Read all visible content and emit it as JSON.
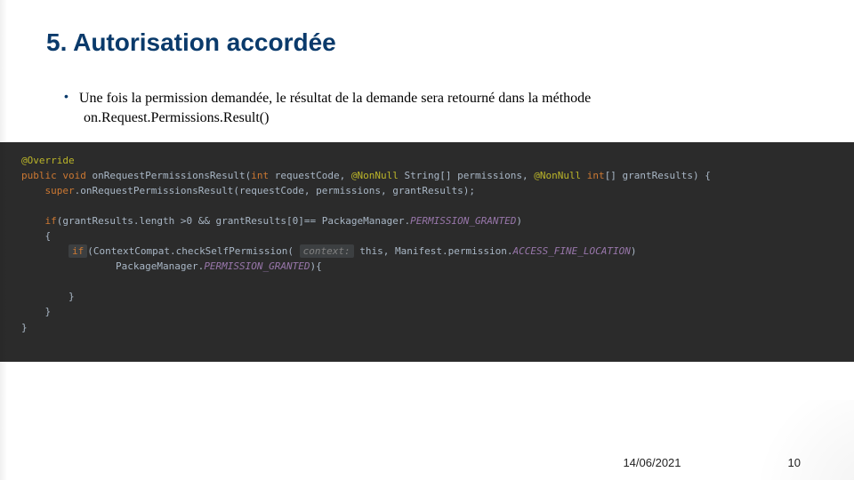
{
  "title": "5. Autorisation accordée",
  "bullet": {
    "text": "Une fois la permission demandée, le résultat de la demande sera retourné dans la méthode",
    "method": "on.Request.Permissions.Result()"
  },
  "code": {
    "l1a": "@Override",
    "l2_kw1": "public void",
    "l2_name": " onRequestPermissionsResult(",
    "l2_kw2": "int",
    "l2_p1": " requestCode, ",
    "l2_ann1": "@NonNull",
    "l2_p2": " String[] permissions, ",
    "l2_ann2": "@NonNull",
    "l2_kw3": " int",
    "l2_p3": "[] grantResults) {",
    "l3_kw": "super",
    "l3_rest": ".onRequestPermissionsResult(requestCode, permissions, grantResults);",
    "l5_kw": "if",
    "l5_rest": "(grantResults.length >0 && grantResults[0]== PackageManager.",
    "l5_const": "PERMISSION_GRANTED",
    "l5_end": ")",
    "l6": "{",
    "l7_kw": "if",
    "l7_a": "(ContextCompat.checkSelfPermission( ",
    "l7_chip": "context:",
    "l7_b": " this, Manifest.permission.",
    "l7_const": "ACCESS_FINE_LOCATION",
    "l7_end": ")",
    "l8_a": "PackageManager.",
    "l8_const": "PERMISSION_GRANTED",
    "l8_end": "){",
    "l10": "}",
    "l11": "}",
    "l12": "}"
  },
  "footer": {
    "date": "14/06/2021",
    "page": "10"
  }
}
